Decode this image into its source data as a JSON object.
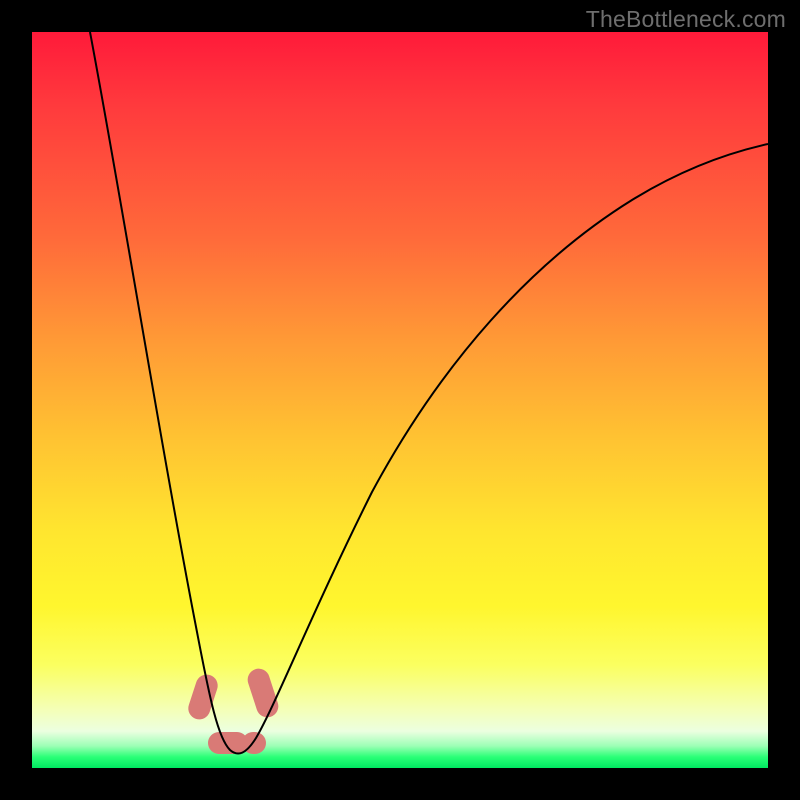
{
  "watermark": "TheBottleneck.com",
  "chart_data": {
    "type": "line",
    "title": "",
    "xlabel": "",
    "ylabel": "",
    "xlim": [
      0,
      100
    ],
    "ylim": [
      0,
      100
    ],
    "series": [
      {
        "name": "bottleneck-curve",
        "x": [
          8,
          10,
          12,
          14,
          16,
          18,
          20,
          22,
          23,
          24,
          25,
          26,
          27,
          28,
          29,
          30,
          32,
          36,
          42,
          50,
          60,
          72,
          86,
          100
        ],
        "values": [
          100,
          88,
          77,
          66,
          55,
          44,
          33,
          20,
          13,
          7,
          3,
          1,
          0,
          0,
          2,
          6,
          14,
          26,
          40,
          52,
          62,
          71,
          78,
          84
        ]
      }
    ],
    "markers": [
      {
        "name": "left-descent-dot",
        "x": 23.5,
        "y": 9
      },
      {
        "name": "trough-left-dot",
        "x": 25.5,
        "y": 1
      },
      {
        "name": "trough-right-dot",
        "x": 28.5,
        "y": 1
      },
      {
        "name": "right-ascent-dot",
        "x": 30.5,
        "y": 9
      }
    ],
    "colors": {
      "curve": "#000000",
      "marker": "#d97a76",
      "gradient_top": "#ff1a3a",
      "gradient_bottom": "#00e861"
    }
  }
}
